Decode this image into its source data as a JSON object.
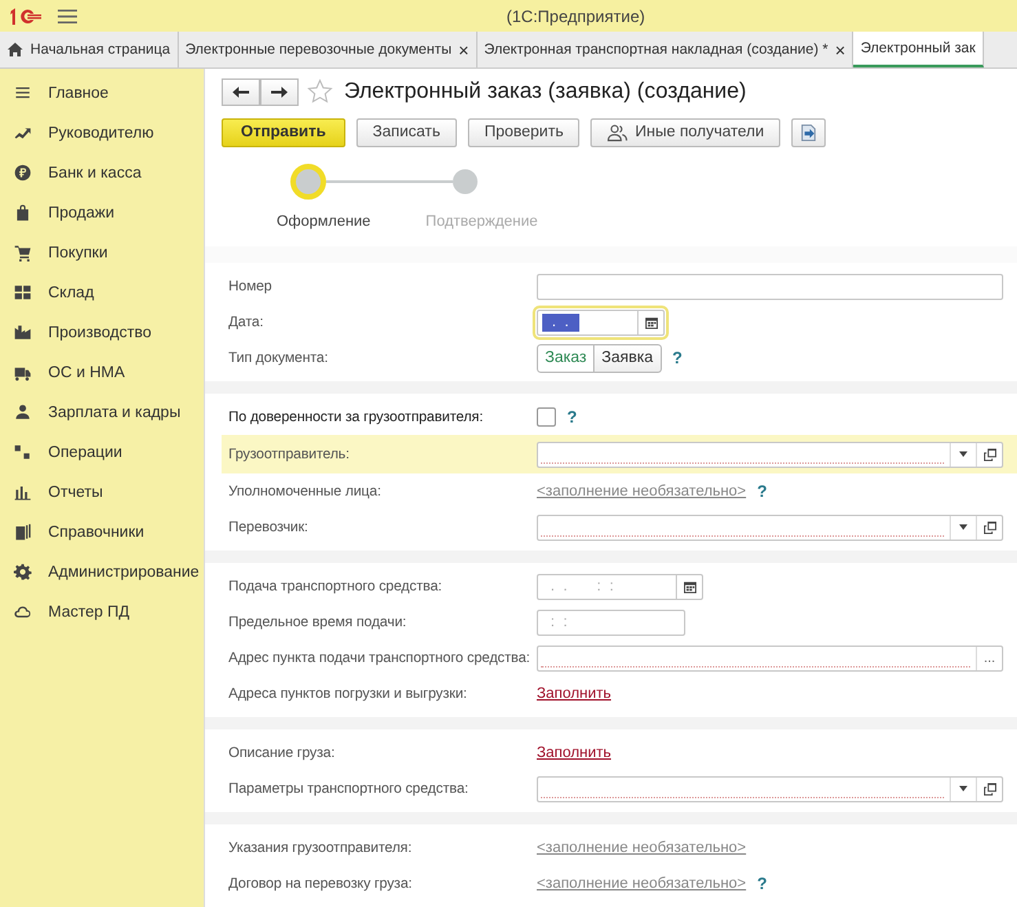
{
  "title_bar": {
    "app": "(1С:Предприятие)"
  },
  "tabs": [
    {
      "label": "Начальная страница",
      "selected": false
    },
    {
      "label": "Электронные перевозочные документы",
      "selected": false,
      "close": "×"
    },
    {
      "label": "Электронная транспортная накладная (создание) *",
      "selected": false,
      "close": "×"
    },
    {
      "label": "Электронный зак",
      "selected": true
    }
  ],
  "sidebar": {
    "items": [
      {
        "label": "Главное"
      },
      {
        "label": "Руководителю"
      },
      {
        "label": "Банк и касса"
      },
      {
        "label": "Продажи"
      },
      {
        "label": "Покупки"
      },
      {
        "label": "Склад"
      },
      {
        "label": "Производство"
      },
      {
        "label": "ОС и НМА"
      },
      {
        "label": "Зарплата и кадры"
      },
      {
        "label": "Операции"
      },
      {
        "label": "Отчеты"
      },
      {
        "label": "Справочники"
      },
      {
        "label": "Администрирование"
      },
      {
        "label": "Мастер ПД"
      }
    ]
  },
  "form": {
    "title": "Электронный заказ (заявка) (создание)",
    "buttons": [
      {
        "label": "Отправить",
        "kind": "primary"
      },
      {
        "label": "Записать",
        "kind": "normal"
      },
      {
        "label": "Проверить",
        "kind": "normal"
      },
      {
        "label": "Иные получатели",
        "kind": "people"
      },
      {
        "kind": "export"
      }
    ],
    "steps": [
      {
        "label": "Оформление",
        "selected": true
      },
      {
        "label": "Подтверждение",
        "selected": false
      }
    ],
    "sections": [
      {
        "rows": [
          {
            "label": "Номер",
            "kind": "text"
          },
          {
            "label": "Дата:",
            "kind": "date",
            "placeholder": " .  .",
            "focused": true
          },
          {
            "label": "Тип документа:",
            "kind": "toggle",
            "options": [
              {
                "label": "Заказ",
                "selected": true
              },
              {
                "label": "Заявка",
                "selected": false
              }
            ],
            "help": "?"
          }
        ]
      },
      {
        "rows": [
          {
            "label": "По доверенности за грузоотправителя:",
            "kind": "checkbox",
            "checked": false,
            "help": "?"
          },
          {
            "label": "Грузоотправитель:",
            "kind": "select",
            "highlighted": true
          },
          {
            "label": "Уполномоченные лица:",
            "kind": "optional_link",
            "link": "<заполнение необязательно>",
            "help": "?"
          },
          {
            "label": "Перевозчик:",
            "kind": "select"
          }
        ]
      },
      {
        "rows": [
          {
            "label": "Подача транспортного средства:",
            "kind": "datetime",
            "placeholder": " .  .       :  :"
          },
          {
            "label": "Предельное время подачи:",
            "kind": "time",
            "placeholder": " :  :"
          },
          {
            "label": "Адрес пункта подачи транспортного средства:",
            "kind": "choice",
            "button": "..."
          },
          {
            "label": "Адреса пунктов погрузки и выгрузки:",
            "kind": "action_link",
            "link": "Заполнить"
          }
        ]
      },
      {
        "rows": [
          {
            "label": "Описание груза:",
            "kind": "action_link",
            "link": "Заполнить"
          },
          {
            "label": "Параметры транспортного средства:",
            "kind": "select"
          }
        ]
      },
      {
        "rows": [
          {
            "label": "Указания грузоотправителя:",
            "kind": "optional_link",
            "link": "<заполнение необязательно>"
          },
          {
            "label": "Договор на перевозку груза:",
            "kind": "optional_link",
            "link": "<заполнение необязательно>",
            "help": "?"
          }
        ]
      }
    ]
  }
}
